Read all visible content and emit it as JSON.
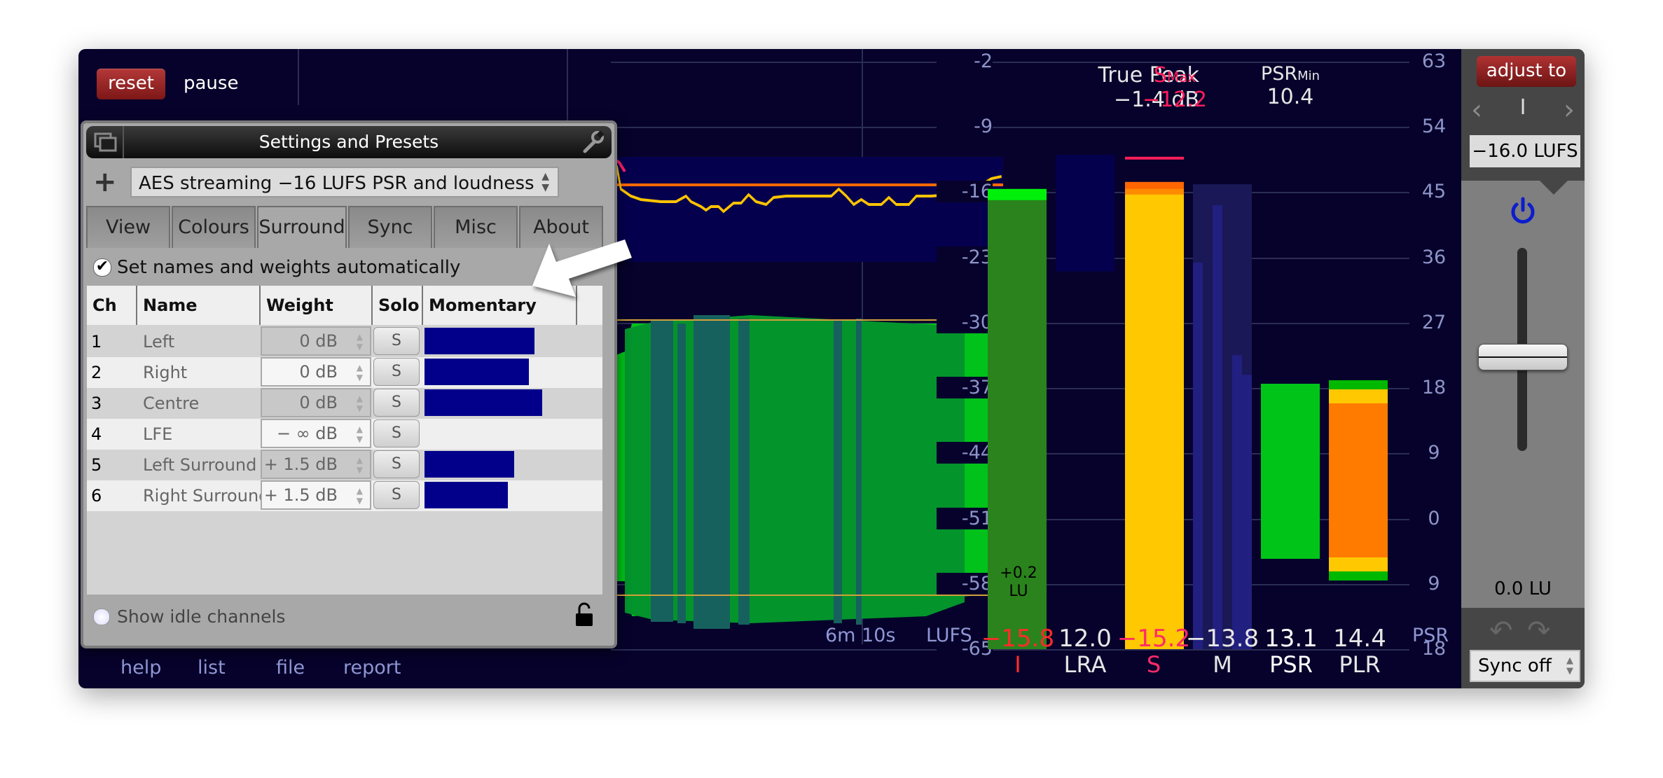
{
  "toolbar": {
    "reset_label": "reset",
    "pause_label": "pause"
  },
  "bottom_links": [
    "help",
    "list",
    "file",
    "report"
  ],
  "history": {
    "time_label": "6m 10s",
    "unit_label": "LUFS"
  },
  "lufs_scale": [
    "-2",
    "-9",
    "-16",
    "-23",
    "-30",
    "-37",
    "-44",
    "-51",
    "-58",
    "-65"
  ],
  "psr_scale": [
    "63",
    "54",
    "45",
    "36",
    "27",
    "18",
    "9",
    "0",
    "9",
    "18"
  ],
  "psr_unit_label": "PSR",
  "true_peak": {
    "label": "True Peak",
    "value": "−1.4 dB"
  },
  "s_max": {
    "label_main": "S",
    "label_sub": "Max",
    "value": "−12.2"
  },
  "psr_min": {
    "label_main": "PSR",
    "label_sub": "Min",
    "value": "10.4"
  },
  "integrated_badge": {
    "line1": "+0.2",
    "line2": "LU"
  },
  "readings": [
    {
      "value": "−15.8",
      "label": "I",
      "color": "#ff2b2b"
    },
    {
      "value": "12.0",
      "label": "LRA",
      "color": "#e6e6e6"
    },
    {
      "value": "−15.2",
      "label": "S",
      "color": "#ff2a6a"
    },
    {
      "value": "−13.8",
      "label": "M",
      "color": "#e6e6e6"
    },
    {
      "value": "13.1",
      "label": "PSR",
      "color": "#ffffff"
    },
    {
      "value": "14.4",
      "label": "PLR",
      "color": "#e6e6e6"
    }
  ],
  "settings": {
    "title": "Settings and Presets",
    "preset": "AES streaming −16 LUFS PSR and loudness",
    "tabs": [
      "View",
      "Colours",
      "Surround",
      "Sync",
      "Misc",
      "About"
    ],
    "active_tab": "Surround",
    "auto_checkbox_label": "Set names and weights automatically",
    "auto_checkbox_checked": true,
    "columns": [
      "Ch",
      "Name",
      "Weight",
      "Solo",
      "Momentary loud."
    ],
    "channels": [
      {
        "ch": "1",
        "name": "Left",
        "weight": "0 dB",
        "solo": "S",
        "momentary": 0.74
      },
      {
        "ch": "2",
        "name": "Right",
        "weight": "0 dB",
        "solo": "S",
        "momentary": 0.7
      },
      {
        "ch": "3",
        "name": "Centre",
        "weight": "0 dB",
        "solo": "S",
        "momentary": 0.79
      },
      {
        "ch": "4",
        "name": "LFE",
        "weight": "− ∞ dB",
        "solo": "S",
        "momentary": 0
      },
      {
        "ch": "5",
        "name": "Left Surround",
        "weight": "+ 1.5 dB",
        "solo": "S",
        "momentary": 0.6
      },
      {
        "ch": "6",
        "name": "Right Surround",
        "weight": "+ 1.5 dB",
        "solo": "S",
        "momentary": 0.56
      }
    ],
    "show_idle_label": "Show idle channels",
    "show_idle_checked": false
  },
  "adjust": {
    "button_label": "adjust to",
    "mode": "I",
    "target": "−16.0 LUFS",
    "fader_value": "0.0 LU",
    "fader_level": 0.5,
    "sync_select": "Sync off",
    "power_on": true
  },
  "meters": {
    "integrated_lufs": -15.8,
    "lra_range_lufs": [
      -24.5,
      -15.0
    ],
    "short_term_lufs": -15.2,
    "short_term_max_lufs": -12.2,
    "momentary_lufs": -13.8,
    "psr": 13.1,
    "plr": 14.4
  }
}
